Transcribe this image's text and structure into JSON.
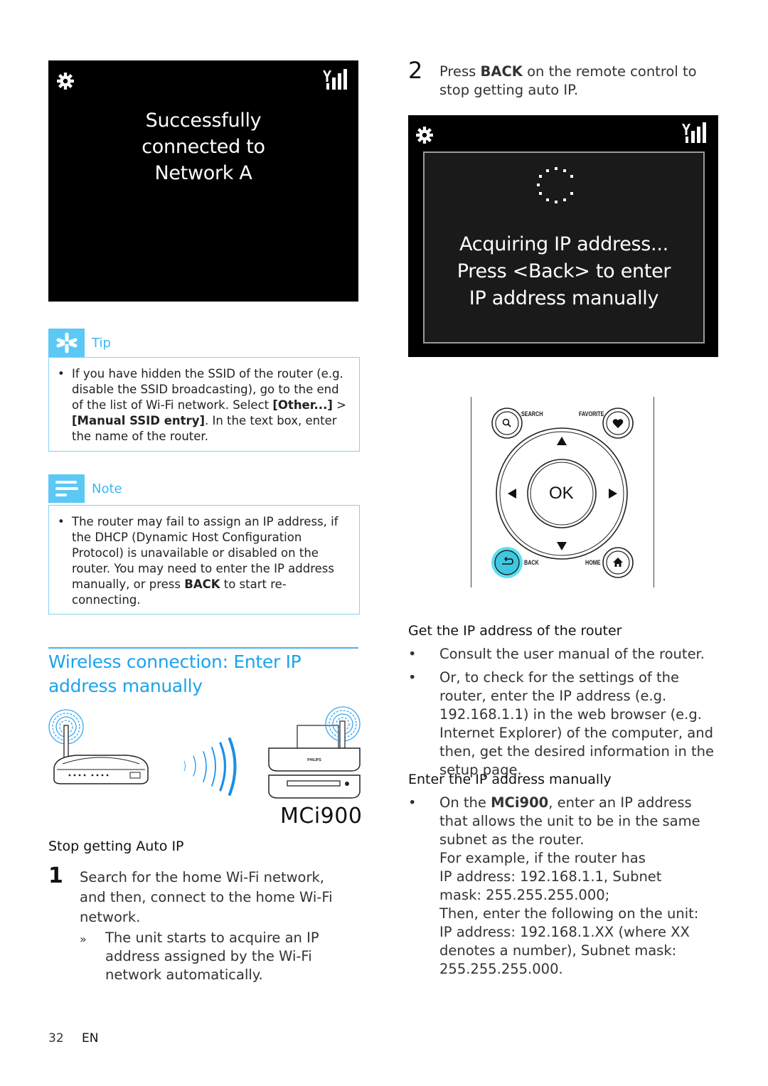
{
  "screen1": {
    "icons": [
      "gear-icon",
      "signal-strength-icon"
    ],
    "lines": [
      "Successfully",
      "connected to",
      "Network A"
    ]
  },
  "tip": {
    "label": "Tip",
    "icon": "asterisk-tip-icon",
    "bullet": "•",
    "text_parts": [
      "If you have hidden the SSID of the router (e.g. disable the SSID broadcasting), go to the end of the list of Wi-Fi network. Select ",
      "[Other...]",
      " > ",
      "[Manual SSID entry]",
      ". In the text box, enter the name of the router."
    ]
  },
  "note": {
    "label": "Note",
    "icon": "note-lines-icon",
    "bullet": "•",
    "text_parts": [
      "The router may fail to assign an IP address, if the DHCP (Dynamic Host Configuration Protocol) is unavailable or disabled on the router. You may need to enter the IP address manually, or press ",
      "BACK",
      " to start re-connecting."
    ]
  },
  "section": {
    "heading": "Wireless connection: Enter IP address manually",
    "model": "MCi900"
  },
  "stop_auto_ip": {
    "heading": "Stop getting Auto IP",
    "step1_num": "1",
    "step1_text": "Search for the home Wi-Fi network, and then, connect to the home Wi-Fi network.",
    "result_mark": "»",
    "result_text": "The unit starts to acquire an IP address assigned by the Wi-Fi network automatically."
  },
  "step2": {
    "num": "2",
    "text_parts": [
      "Press ",
      "BACK",
      " on the remote control to stop getting auto IP."
    ]
  },
  "screen2": {
    "icons": [
      "gear-icon",
      "signal-strength-icon",
      "loading-spinner-icon"
    ],
    "lines": [
      "Acquiring IP address...",
      "Press <Back> to enter",
      "IP address manually"
    ]
  },
  "remote": {
    "search_label": "SEARCH",
    "favorite_label": "FAVORITE",
    "ok_label": "OK",
    "back_label": "BACK",
    "home_label": "HOME",
    "highlight_color": "#5ee0ee"
  },
  "get_router_ip": {
    "heading": "Get the IP address of the router",
    "bullet": "•",
    "items": [
      "Consult the user manual of the router.",
      "Or, to check for the settings of the router, enter the IP address (e.g. 192.168.1.1) in the web browser (e.g. Internet Explorer) of the computer, and then, get the desired information in the setup page."
    ]
  },
  "enter_manual": {
    "heading": "Enter the IP address manually",
    "bullet": "•",
    "lead_parts": [
      "On the ",
      "MCi900",
      ", enter an IP address that allows the unit to be in the same subnet as the router."
    ],
    "lines": [
      "For example, if the router has",
      "IP address: 192.168.1.1, Subnet mask: 255.255.255.000;",
      "Then, enter the following on the unit:",
      "IP address: 192.168.1.XX (where XX denotes a number), Subnet mask: 255.255.255.000."
    ]
  },
  "footer": {
    "page": "32",
    "lang": "EN"
  },
  "colors": {
    "accent": "#1aa3ec",
    "callout": "#5bc8f5",
    "screen_bg": "#000000"
  }
}
